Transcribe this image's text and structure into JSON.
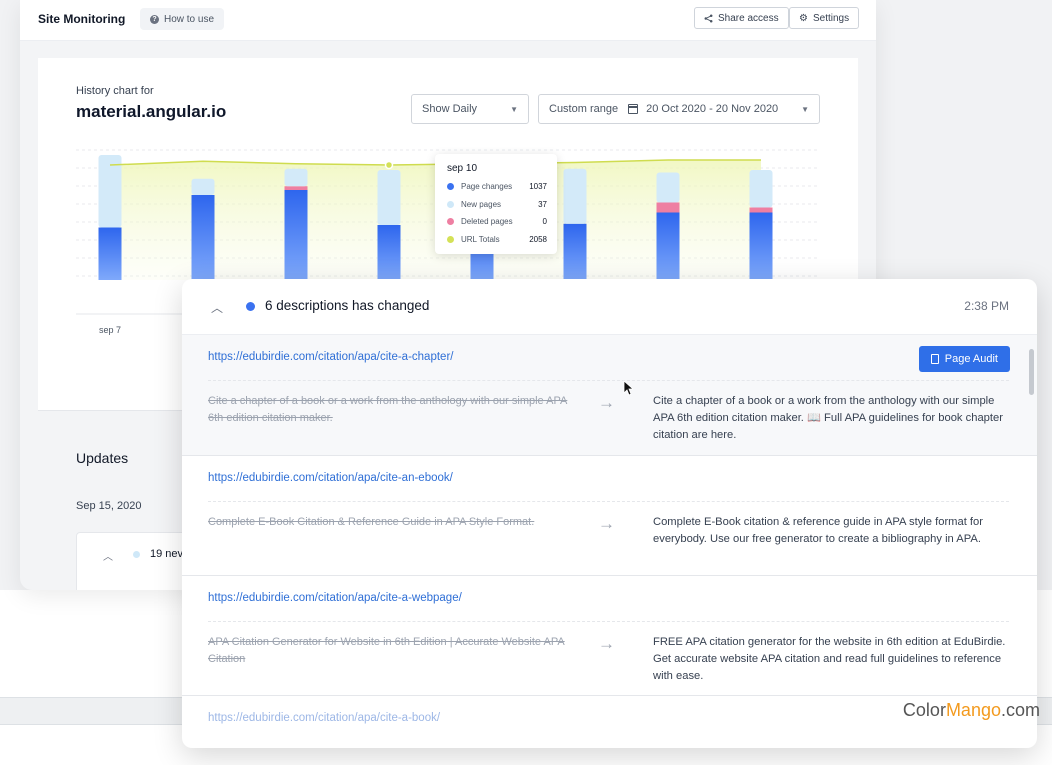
{
  "topbar": {
    "app_title": "Site Monitoring",
    "how_to_use": "How to use",
    "share_access": "Share access",
    "settings": "Settings"
  },
  "history": {
    "label": "History chart for",
    "site": "material.angular.io",
    "show_select": "Show Daily",
    "custom_range_label": "Custom range",
    "date_range": "20 Oct 2020 - 20 Nov 2020"
  },
  "chart_data": {
    "type": "bar",
    "x_labels_visible": [
      "sep 7"
    ],
    "series": [
      {
        "name": "Page changes",
        "color": "#3b72f0",
        "values": [
          0.42,
          0.68,
          0.72,
          0.44,
          0.4,
          0.45,
          0.54,
          0.54
        ]
      },
      {
        "name": "New pages",
        "color": "#cfe8f8",
        "values": [
          0.58,
          0.13,
          0.14,
          0.44,
          0.5,
          0.44,
          0.24,
          0.3
        ]
      },
      {
        "name": "Deleted pages",
        "color": "#ee7fa2",
        "values": [
          0,
          0,
          0.03,
          0,
          0,
          0,
          0.08,
          0.04
        ]
      },
      {
        "name": "URL Totals",
        "color": "#d4e157",
        "values": [
          0.92,
          0.95,
          0.93,
          0.92,
          0.93,
          0.94,
          0.96,
          0.96
        ]
      }
    ],
    "tooltip": {
      "title": "sep 10",
      "rows": [
        {
          "label": "Page changes",
          "value": "1037",
          "color": "#3b72f0"
        },
        {
          "label": "New pages",
          "value": "37",
          "color": "#cfe8f8"
        },
        {
          "label": "Deleted pages",
          "value": "0",
          "color": "#ee7fa2"
        },
        {
          "label": "URL Totals",
          "value": "2058",
          "color": "#d4e157"
        }
      ]
    }
  },
  "updates": {
    "title": "Updates",
    "date": "Sep 15, 2020",
    "mini_text": "19 nev"
  },
  "card": {
    "title": "6 descriptions has changed",
    "time": "2:38 PM",
    "audit_label": "Page Audit",
    "items": [
      {
        "url": "https://edubirdie.com/citation/apa/cite-a-chapter/",
        "old": "Cite a chapter of a book or a work from the anthology with our simple APA 6th edition citation maker.",
        "new": "Cite a chapter of a book or a work from the anthology with our simple APA 6th edition citation maker. 📖 Full APA guidelines for book chapter citation are here."
      },
      {
        "url": "https://edubirdie.com/citation/apa/cite-an-ebook/",
        "old": "Complete E-Book Citation & Reference Guide in APA Style Format.",
        "new": "Complete E-Book citation & reference guide in APA style format for everybody. Use our free generator to create a bibliography in APA."
      },
      {
        "url": "https://edubirdie.com/citation/apa/cite-a-webpage/",
        "old": "APA Citation Generator for Website in 6th Edition | Accurate Website APA Citation",
        "new": "FREE APA citation generator for the website in 6th edition at EduBirdie. Get accurate website APA citation and read full guidelines to reference with ease."
      },
      {
        "url": "https://edubirdie.com/citation/apa/cite-a-book/"
      }
    ]
  },
  "brand": {
    "part1": "Color",
    "part2": "Mango",
    "part3": ".com"
  }
}
